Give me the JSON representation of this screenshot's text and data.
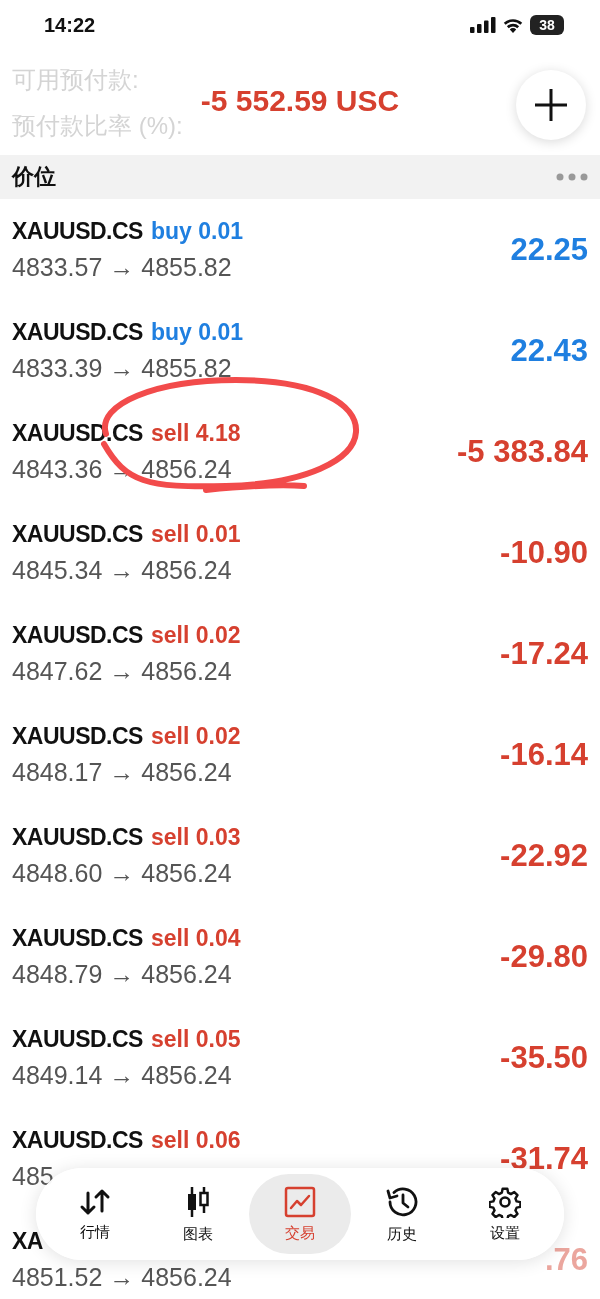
{
  "status_bar": {
    "time": "14:22",
    "battery": "38"
  },
  "account": {
    "labels": [
      "可用预付款:",
      "预付款比率 (%):"
    ],
    "total": "-5 552.59 USC",
    "color": "#d6402f"
  },
  "section": {
    "title": "价位"
  },
  "positions": [
    {
      "symbol": "XAUUSD.CS",
      "volume": "buy 0.01",
      "prices": "4833.57 → 4855.82",
      "profit": "22.25",
      "color": "#1f7fe0"
    },
    {
      "symbol": "XAUUSD.CS",
      "volume": "buy 0.01",
      "prices": "4833.39 → 4855.82",
      "profit": "22.43",
      "color": "#1f7fe0"
    },
    {
      "symbol": "XAUUSD.CS",
      "volume": "sell 4.18",
      "prices": "4843.36 → 4856.24",
      "profit": "-5 383.84",
      "color": "#d6402f"
    },
    {
      "symbol": "XAUUSD.CS",
      "volume": "sell 0.01",
      "prices": "4845.34 → 4856.24",
      "profit": "-10.90",
      "color": "#d6402f"
    },
    {
      "symbol": "XAUUSD.CS",
      "volume": "sell 0.02",
      "prices": "4847.62 → 4856.24",
      "profit": "-17.24",
      "color": "#d6402f"
    },
    {
      "symbol": "XAUUSD.CS",
      "volume": "sell 0.02",
      "prices": "4848.17 → 4856.24",
      "profit": "-16.14",
      "color": "#d6402f"
    },
    {
      "symbol": "XAUUSD.CS",
      "volume": "sell 0.03",
      "prices": "4848.60 → 4856.24",
      "profit": "-22.92",
      "color": "#d6402f"
    },
    {
      "symbol": "XAUUSD.CS",
      "volume": "sell 0.04",
      "prices": "4848.79 → 4856.24",
      "profit": "-29.80",
      "color": "#d6402f"
    },
    {
      "symbol": "XAUUSD.CS",
      "volume": "sell 0.05",
      "prices": "4849.14 → 4856.24",
      "profit": "-35.50",
      "color": "#d6402f"
    },
    {
      "symbol": "XAUUSD.CS",
      "volume": "sell 0.06",
      "prices": "485",
      "profit": "-31.74",
      "color": "#d6402f"
    },
    {
      "symbol": "XA",
      "prices": "4851.52 → 4856.24",
      "profit": ".76",
      "color": "#eba69e"
    }
  ],
  "tab_bar": [
    {
      "label": "行情",
      "kind": "quotes",
      "selected": false
    },
    {
      "label": "图表",
      "kind": "chart",
      "selected": false
    },
    {
      "label": "交易",
      "kind": "trade",
      "selected": true
    },
    {
      "label": "历史",
      "kind": "history",
      "selected": false
    },
    {
      "label": "设置",
      "kind": "settings",
      "selected": false
    }
  ]
}
